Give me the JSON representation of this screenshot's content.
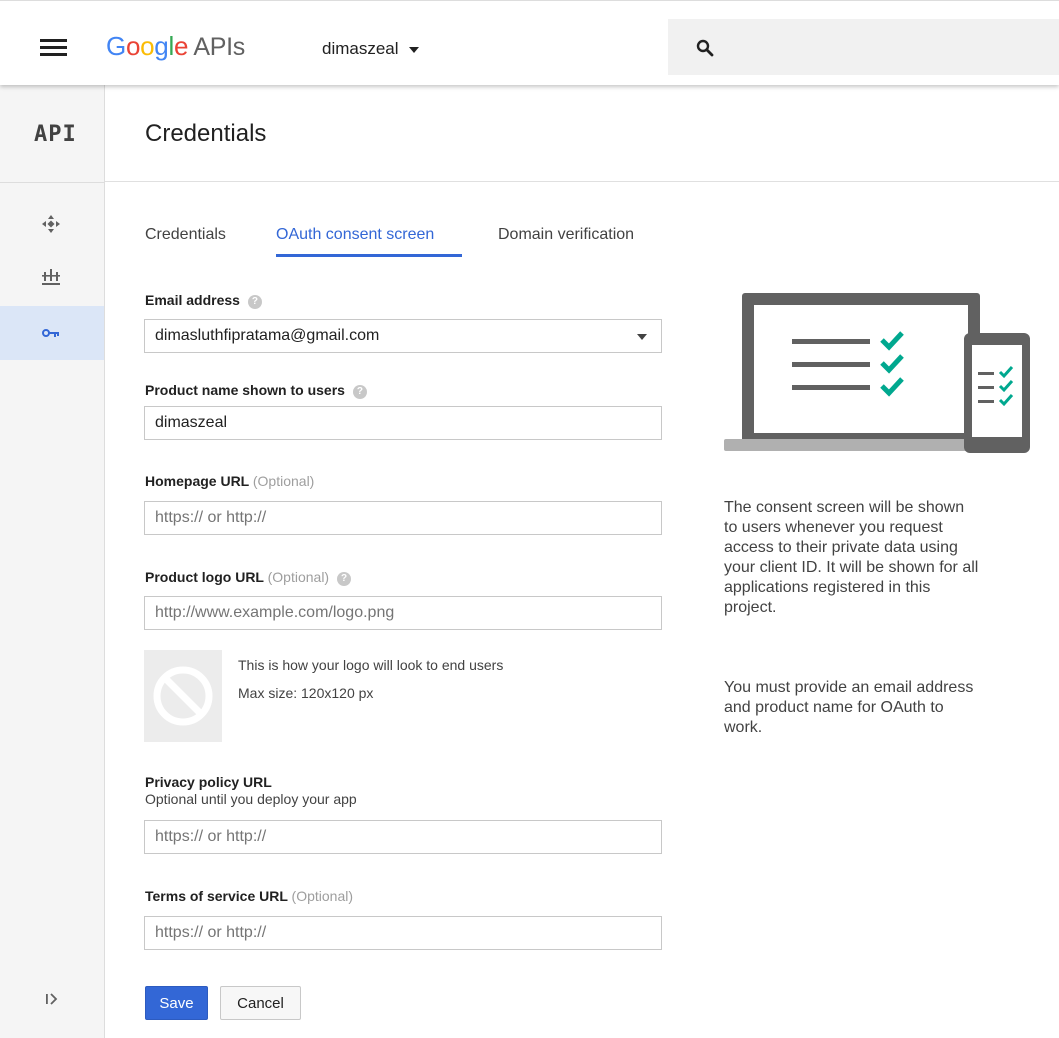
{
  "topbar": {
    "brand_google": "Google",
    "brand_apis": " APIs",
    "project": "dimaszeal",
    "icons": [
      "menu-icon",
      "chevron-down-icon",
      "search-icon"
    ]
  },
  "sidebar": {
    "logo": "API",
    "items": [
      {
        "name": "dashboard",
        "icon": "diamond-arrows-icon",
        "active": false
      },
      {
        "name": "library",
        "icon": "library-icon",
        "active": false
      },
      {
        "name": "credentials",
        "icon": "key-icon",
        "active": true
      }
    ],
    "expand_icon": "expand-icon"
  },
  "page": {
    "title": "Credentials"
  },
  "tabs": [
    {
      "label": "Credentials",
      "active": false
    },
    {
      "label": "OAuth consent screen",
      "active": true
    },
    {
      "label": "Domain verification",
      "active": false
    }
  ],
  "form": {
    "email": {
      "label": "Email address",
      "value": "dimasluthfipratama@gmail.com"
    },
    "product_name": {
      "label": "Product name shown to users",
      "value": "dimaszeal"
    },
    "homepage": {
      "label": "Homepage URL",
      "optional": "(Optional)",
      "placeholder": "https:// or http://"
    },
    "logo_url": {
      "label": "Product logo URL",
      "optional": "(Optional)",
      "placeholder": "http://www.example.com/logo.png"
    },
    "logo_preview": {
      "line1": "This is how your logo will look to end users",
      "line2": "Max size: 120x120 px"
    },
    "privacy": {
      "label": "Privacy policy URL",
      "sublabel": "Optional until you deploy your app",
      "placeholder": "https:// or http://"
    },
    "terms": {
      "label": "Terms of service URL",
      "optional": "(Optional)",
      "placeholder": "https:// or http://"
    },
    "save_label": "Save",
    "cancel_label": "Cancel"
  },
  "info": {
    "p1_lines": [
      "The consent screen will be shown",
      "to users whenever you request",
      "access to their private data using",
      "your client ID. It will be shown for all",
      "applications registered in this",
      "project."
    ],
    "p2_lines": [
      "You must provide an email address",
      "and product name for OAuth to",
      "work."
    ]
  },
  "colors": {
    "accent": "#3367d6",
    "check": "#00a88f",
    "active_nav_bg": "#dbe6f7"
  }
}
